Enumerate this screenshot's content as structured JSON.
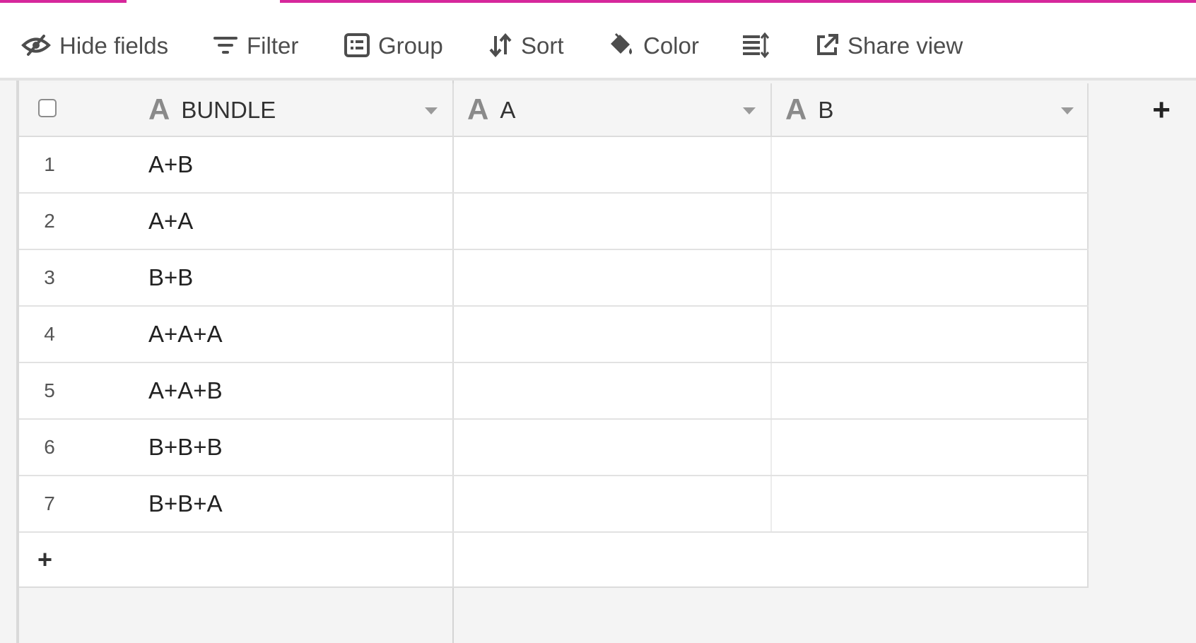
{
  "toolbar": {
    "hide_fields": {
      "label": "Hide fields",
      "icon": "eye-slash-icon"
    },
    "filter": {
      "label": "Filter",
      "icon": "filter-icon"
    },
    "group": {
      "label": "Group",
      "icon": "group-list-icon"
    },
    "sort": {
      "label": "Sort",
      "icon": "sort-arrows-icon"
    },
    "color": {
      "label": "Color",
      "icon": "paint-bucket-icon"
    },
    "row_height": {
      "icon": "row-height-icon"
    },
    "share_view": {
      "label": "Share view",
      "icon": "share-external-icon"
    }
  },
  "columns": [
    {
      "glyph": "A",
      "name": "BUNDLE",
      "type_icon": "text-field-icon"
    },
    {
      "glyph": "A",
      "name": "A",
      "type_icon": "text-field-icon"
    },
    {
      "glyph": "A",
      "name": "B",
      "type_icon": "text-field-icon"
    }
  ],
  "add_column": {
    "label": "+"
  },
  "rows": [
    {
      "num": "1",
      "bundle": "A+B",
      "a": "",
      "b": ""
    },
    {
      "num": "2",
      "bundle": "A+A",
      "a": "",
      "b": ""
    },
    {
      "num": "3",
      "bundle": "B+B",
      "a": "",
      "b": ""
    },
    {
      "num": "4",
      "bundle": "A+A+A",
      "a": "",
      "b": ""
    },
    {
      "num": "5",
      "bundle": "A+A+B",
      "a": "",
      "b": ""
    },
    {
      "num": "6",
      "bundle": "B+B+B",
      "a": "",
      "b": ""
    },
    {
      "num": "7",
      "bundle": "B+B+A",
      "a": "",
      "b": ""
    }
  ],
  "add_row": {
    "label": "+"
  },
  "colors": {
    "accent": "#d6279b",
    "toolbar_text": "#4d4d4d",
    "grid_bg": "#f4f4f4"
  }
}
